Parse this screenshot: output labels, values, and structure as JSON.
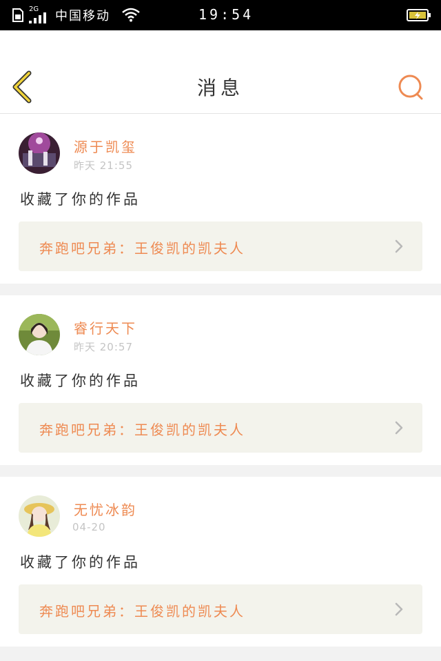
{
  "status_bar": {
    "net_type": "2G",
    "carrier": "中国移动",
    "time": "19:54"
  },
  "header": {
    "title": "消息"
  },
  "messages": [
    {
      "username": "源于凯玺",
      "time": "昨天 21:55",
      "action": "收藏了你的作品",
      "work_title": "奔跑吧兄弟：王俊凯的凯夫人"
    },
    {
      "username": "睿行天下",
      "time": "昨天 20:57",
      "action": "收藏了你的作品",
      "work_title": "奔跑吧兄弟：王俊凯的凯夫人"
    },
    {
      "username": "无忧冰韵",
      "time": "04-20",
      "action": "收藏了你的作品",
      "work_title": "奔跑吧兄弟：王俊凯的凯夫人"
    }
  ],
  "colors": {
    "accent": "#ee8a52",
    "back_arrow": "#f0d33a",
    "work_box_bg": "#f3f3ec"
  }
}
